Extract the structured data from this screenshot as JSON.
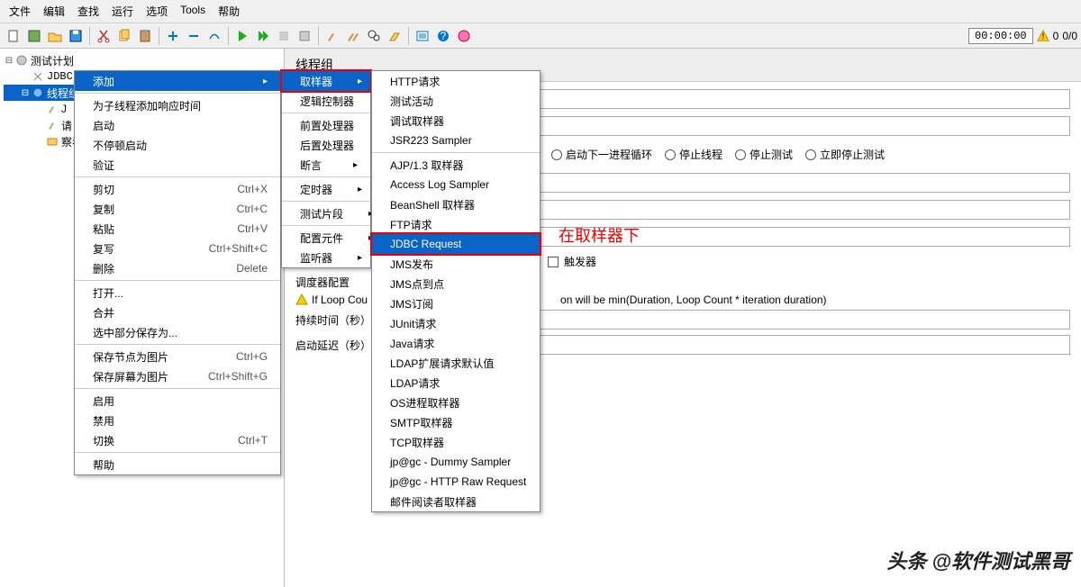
{
  "menubar": [
    "文件",
    "编辑",
    "查找",
    "运行",
    "选项",
    "Tools",
    "帮助"
  ],
  "status": {
    "time": "00:00:00",
    "warn1": "0",
    "warn2": "0/0"
  },
  "tree": {
    "root": "测试计划",
    "jdbc": "JDBC Connection Configuration",
    "thread": "线程组",
    "j": "J",
    "item4": "请",
    "item5": "察看"
  },
  "content": {
    "title": "线程组",
    "chkrow_label": "触发器",
    "radios": [
      "启动下一进程循环",
      "停止线程",
      "停止测试",
      "立即停止测试"
    ],
    "scheduler": "调度器配置",
    "loopwarn": "If Loop Cou",
    "loopwarn_tail": "on will be min(Duration, Loop Count * iteration duration)",
    "duration": "持续时间（秒）",
    "delay": "启动延迟（秒）"
  },
  "menu1": [
    {
      "l": "添加",
      "a": true,
      "sel": true
    },
    "-",
    {
      "l": "为子线程添加响应时间"
    },
    {
      "l": "启动"
    },
    {
      "l": "不停顿启动"
    },
    {
      "l": "验证"
    },
    "-",
    {
      "l": "剪切",
      "sc": "Ctrl+X"
    },
    {
      "l": "复制",
      "sc": "Ctrl+C"
    },
    {
      "l": "粘贴",
      "sc": "Ctrl+V"
    },
    {
      "l": "复写",
      "sc": "Ctrl+Shift+C"
    },
    {
      "l": "删除",
      "sc": "Delete"
    },
    "-",
    {
      "l": "打开..."
    },
    {
      "l": "合并"
    },
    {
      "l": "选中部分保存为..."
    },
    "-",
    {
      "l": "保存节点为图片",
      "sc": "Ctrl+G"
    },
    {
      "l": "保存屏幕为图片",
      "sc": "Ctrl+Shift+G"
    },
    "-",
    {
      "l": "启用"
    },
    {
      "l": "禁用"
    },
    {
      "l": "切换",
      "sc": "Ctrl+T"
    },
    "-",
    {
      "l": "帮助"
    }
  ],
  "menu2": [
    {
      "l": "取样器",
      "a": true,
      "sel": true,
      "red": true
    },
    {
      "l": "逻辑控制器",
      "a": true
    },
    "-",
    {
      "l": "前置处理器",
      "a": true
    },
    {
      "l": "后置处理器",
      "a": true
    },
    {
      "l": "断言",
      "a": true
    },
    "-",
    {
      "l": "定时器",
      "a": true
    },
    "-",
    {
      "l": "测试片段",
      "a": true
    },
    "-",
    {
      "l": "配置元件",
      "a": true
    },
    {
      "l": "监听器",
      "a": true
    }
  ],
  "menu3": [
    "HTTP请求",
    "测试活动",
    "调试取样器",
    "JSR223 Sampler",
    "-",
    "AJP/1.3 取样器",
    "Access Log Sampler",
    "BeanShell 取样器",
    "FTP请求",
    {
      "l": "JDBC Request",
      "sel": true,
      "red": true
    },
    "JMS发布",
    "JMS点到点",
    "JMS订阅",
    "JUnit请求",
    "Java请求",
    "LDAP扩展请求默认值",
    "LDAP请求",
    "OS进程取样器",
    "SMTP取样器",
    "TCP取样器",
    "jp@gc - Dummy Sampler",
    "jp@gc - HTTP Raw Request",
    "邮件阅读者取样器"
  ],
  "annotation": "在取样器下",
  "watermark": "头条 @软件测试黑哥"
}
